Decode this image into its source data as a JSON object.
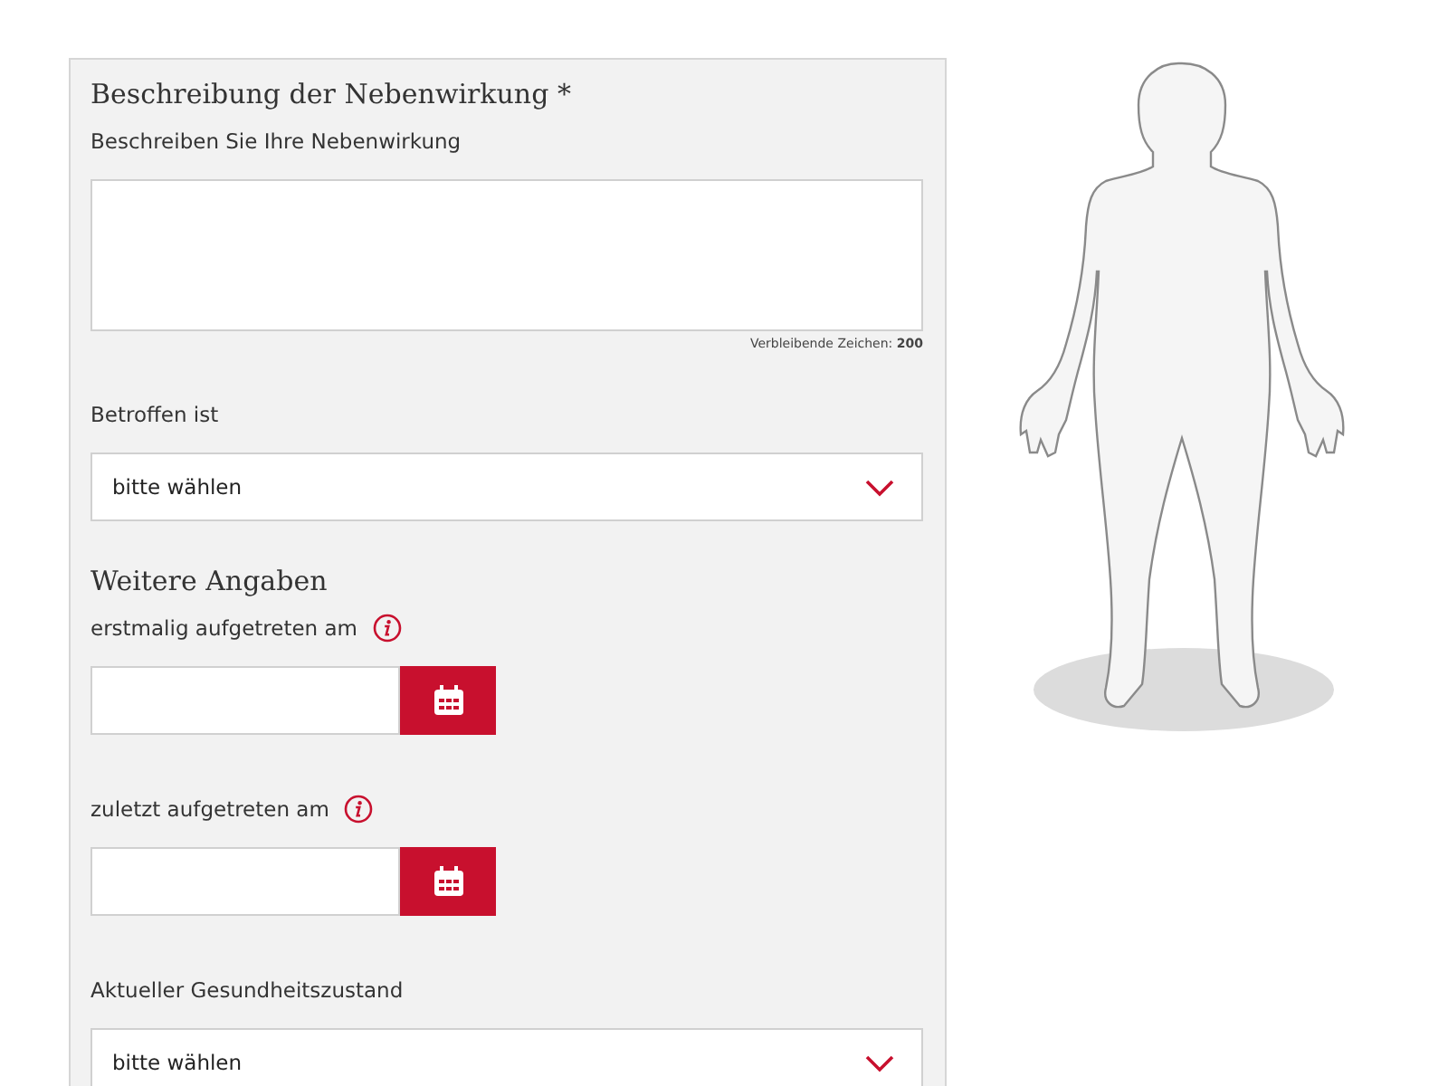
{
  "form": {
    "fields": [
      {
        "kind": "heading",
        "text": "Beschreibung der Nebenwirkung *"
      },
      {
        "kind": "textarea",
        "label": "Beschreiben Sie Ihre Nebenwirkung",
        "counter": "Verbleibende Zeichen: **200**"
      },
      {
        "kind": "select",
        "label": "Betroffen ist",
        "value": "bitte wählen"
      },
      {
        "kind": "heading",
        "text": "Weitere Angaben"
      },
      {
        "kind": "date",
        "label": "erstmalig aufgetreten am",
        "info": true
      },
      {
        "kind": "date",
        "label": "zuletzt aufgetreten am",
        "info": true
      },
      {
        "kind": "select",
        "label": "Aktueller Gesundheitszustand",
        "value": "bitte wählen"
      }
    ]
  }
}
